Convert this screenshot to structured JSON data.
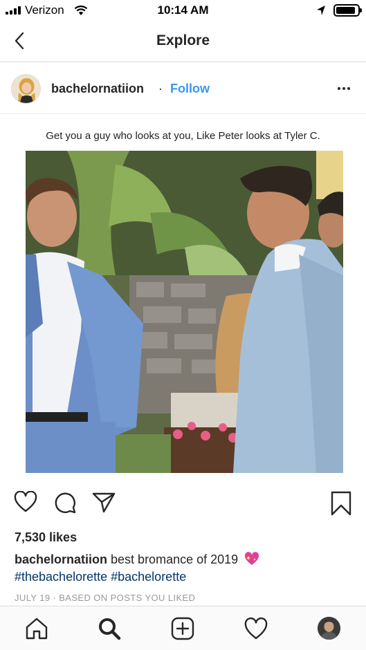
{
  "status_bar": {
    "carrier": "Verizon",
    "time": "10:14 AM",
    "battery_level": 0.9,
    "icons": [
      "signal-icon",
      "wifi-icon",
      "location-icon",
      "battery-icon"
    ]
  },
  "nav": {
    "title": "Explore",
    "back_icon": "chevron-left-icon"
  },
  "post": {
    "username": "bachelornatiion",
    "separator": "·",
    "follow_label": "Follow",
    "more_icon": "more-horizontal-icon",
    "image_caption": "Get you a guy who looks at you, Like Peter looks at Tyler C.",
    "likes": "7,530 likes",
    "caption_user": "bachelornatiion",
    "caption_text": "best bromance of 2019",
    "caption_emoji": "sparkling-heart-icon",
    "hashtags": [
      "#thebachelorette",
      "#bachelorette"
    ],
    "timestamp": "JULY 19 · BASED ON POSTS YOU LIKED"
  },
  "actions": {
    "like_icon": "heart-icon",
    "comment_icon": "comment-icon",
    "share_icon": "paper-plane-icon",
    "save_icon": "bookmark-icon"
  },
  "tab_bar": {
    "items": [
      "home-icon",
      "search-icon",
      "add-post-icon",
      "activity-heart-icon",
      "profile-avatar"
    ],
    "active": "search-icon"
  },
  "colors": {
    "follow_blue": "#3897f0",
    "hashtag_blue": "#003569",
    "text": "#262626",
    "muted": "#999999",
    "divider": "#dbdbdb"
  }
}
